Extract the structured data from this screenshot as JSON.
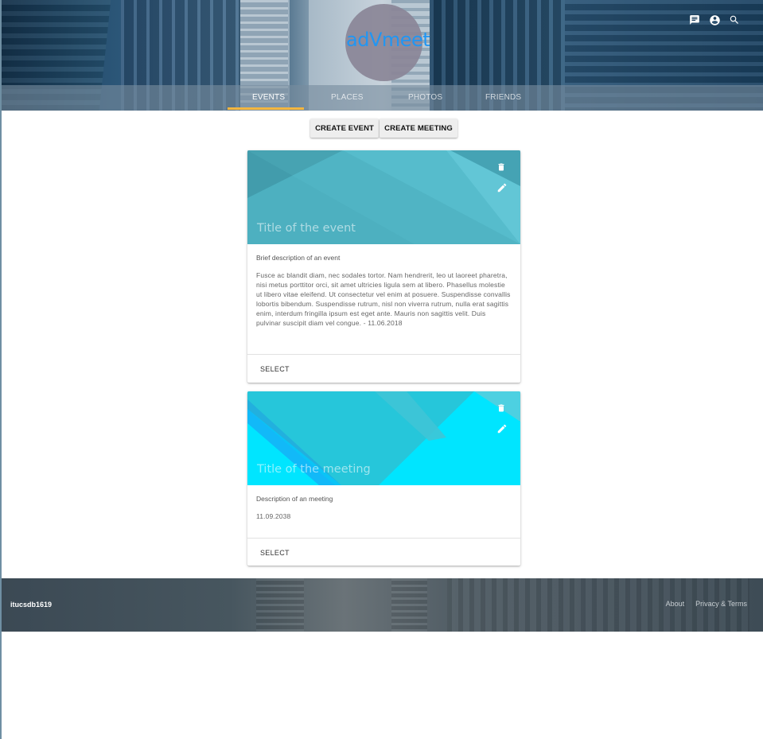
{
  "header": {
    "logo_text": "adVmeet",
    "icons": [
      "chat-icon",
      "account-icon",
      "search-icon"
    ]
  },
  "nav": {
    "tabs": [
      {
        "label": "EVENTS",
        "active": true
      },
      {
        "label": "PLACES",
        "active": false
      },
      {
        "label": "PHOTOS",
        "active": false
      },
      {
        "label": "FRIENDS",
        "active": false
      }
    ]
  },
  "actions": {
    "create_event": "CREATE EVENT",
    "create_meeting": "CREATE MEETING"
  },
  "cards": [
    {
      "title": "Title of the event",
      "subtitle": "Brief description of an event",
      "body": "Fusce ac blandit diam, nec sodales tortor. Nam hendrerit, leo ut laoreet pharetra, nisi metus porttitor orci, sit amet ultricies ligula sem at libero. Phasellus molestie ut libero vitae eleifend. Ut consectetur vel enim at posuere. Suspendisse convallis lobortis bibendum. Suspendisse rutrum, nisl non viverra rutrum, nulla erat sagittis enim, interdum fringilla ipsum est eget ante. Mauris non sagittis velit. Duis pulvinar suscipit diam vel congue. - 11.06.2018",
      "action": "SELECT",
      "colors": {
        "base": "#4fb8c8",
        "light": "#6fd0de",
        "dark": "#3a98aa"
      }
    },
    {
      "title": "Title of the meeting",
      "subtitle": "Description of an meeting",
      "body": "11.09.2038",
      "action": "SELECT",
      "colors": {
        "base": "#00e5ff",
        "light": "#26c6da",
        "dark": "#1aa9c0"
      }
    }
  ],
  "footer": {
    "brand": "itucsdb1619",
    "links": [
      "About",
      "Privacy & Terms"
    ]
  },
  "theme": {
    "accent": "#f4b63f",
    "logo_blue": "#2196f3"
  }
}
